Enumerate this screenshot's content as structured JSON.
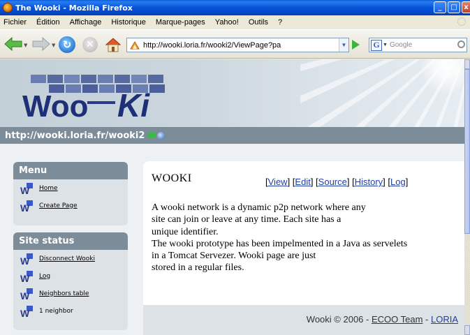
{
  "window": {
    "title": "The Wooki - Mozilla Firefox",
    "buttons": {
      "minimize": "_",
      "maximize": "□",
      "close": "x"
    }
  },
  "menubar": {
    "items": [
      {
        "label": "Fichier"
      },
      {
        "label": "Édition"
      },
      {
        "label": "Affichage"
      },
      {
        "label": "Historique"
      },
      {
        "label": "Marque-pages"
      },
      {
        "label": "Yahoo!"
      },
      {
        "label": "Outils"
      },
      {
        "label": "?"
      }
    ]
  },
  "toolbar": {
    "address": "http://wooki.loria.fr/wooki2/ViewPage?pa",
    "search_placeholder": "Google",
    "search_engine_letter": "G",
    "icons": [
      "back-arrow",
      "forward-arrow",
      "reload",
      "stop",
      "home",
      "go",
      "search"
    ]
  },
  "site": {
    "logo_text_1": "Woo",
    "logo_text_2": "Ki",
    "url_strip": "http://wooki.loria.fr/wooki2"
  },
  "sidebar": {
    "menu": {
      "title": "Menu",
      "items": [
        {
          "label": "Home"
        },
        {
          "label": "Create Page"
        }
      ]
    },
    "status": {
      "title": "Site status",
      "items": [
        {
          "label": "Disconnect Wooki"
        },
        {
          "label": "Log"
        },
        {
          "label": "Neighbors table"
        },
        {
          "label": "1 neighbor"
        }
      ]
    }
  },
  "content": {
    "title": "WOOKI",
    "actions": [
      {
        "label": "View"
      },
      {
        "label": "Edit"
      },
      {
        "label": "Source"
      },
      {
        "label": "History"
      },
      {
        "label": "Log"
      }
    ],
    "body": [
      "A wooki network is a dynamic p2p network where any",
      "site can join or leave at any time. Each site has a",
      "unique identifier.",
      "The wooki prototype has been impelmented in a Java as servelets",
      "in a Tomcat Servezer. Wooki page are just",
      "stored in a regular files."
    ],
    "footer": {
      "prefix": "Wooki © 2006 - ",
      "team": "ECOO Team",
      "sep": " - ",
      "org": "LORIA"
    }
  },
  "colors": {
    "accent": "#7c8c98",
    "panel_bg": "#dce2e6",
    "link": "#2040a0"
  }
}
